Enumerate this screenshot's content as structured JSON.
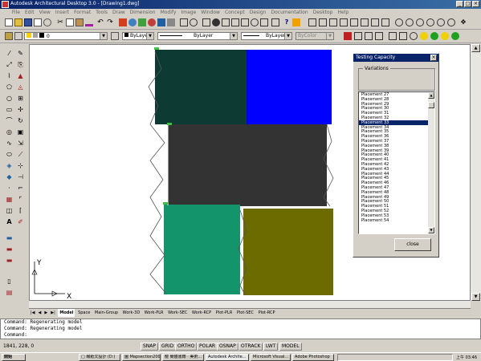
{
  "window": {
    "title": "Autodesk Architectural Desktop 3.0 - [Drawing1.dwg]",
    "minimize": "_",
    "maximize": "□",
    "close": "×"
  },
  "menu": [
    "File",
    "Edit",
    "View",
    "Insert",
    "Format",
    "Tools",
    "Draw",
    "Dimension",
    "Modify",
    "Image",
    "Window",
    "Concept",
    "Design",
    "Documentation",
    "Desktop",
    "Help"
  ],
  "toolbar": {
    "layer_combo": "0",
    "color_combo": "ByLayer",
    "linetype_combo": "ByLayer",
    "lineweight_combo": "ByLayer",
    "plotstyle_combo": "ByColor"
  },
  "canvas": {
    "ucs_y": "Y",
    "ucs_x": "X"
  },
  "tabs": [
    "Model",
    "Space",
    "Main-Group",
    "Work-3D",
    "Work-PLR",
    "Work-SEC",
    "Work-RCP",
    "Plot-PLR",
    "Plot-SEC",
    "Plot-RCP"
  ],
  "command": {
    "lines": [
      "Command:  Regenerating model",
      "Command:  Regenerating model",
      "Command:"
    ]
  },
  "status": {
    "coords": "1841, 228, 0",
    "toggles": [
      "SNAP",
      "GRID",
      "ORTHO",
      "POLAR",
      "OSNAP",
      "OTRACK",
      "LWT",
      "MODEL"
    ]
  },
  "taskbar": {
    "start": "開始",
    "tasks": [
      "□ 報紙文設計 (D:)",
      "圖 Mapsection2008-1...",
      "龍 簡體書籍 · 美術...",
      "Autodesk Archite...",
      "Microsoft Visual...",
      "Adobe Photoshop"
    ],
    "clock": "上午 03:46"
  },
  "dialog": {
    "title": "Testing Capacity",
    "group_label": "Variations",
    "items": [
      "Placement 27",
      "Placement 28",
      "Placement 29",
      "Placement 30",
      "Placement 31",
      "Placement 32",
      "Placement 33",
      "Placement 34",
      "Placement 35",
      "Placement 36",
      "Placement 37",
      "Placement 38",
      "Placement 39",
      "Placement 40",
      "Placement 41",
      "Placement 42",
      "Placement 43",
      "Placement 44",
      "Placement 45",
      "Placement 46",
      "Placement 47",
      "Placement 48",
      "Placement 49",
      "Placement 50",
      "Placement 51",
      "Placement 52",
      "Placement 53",
      "Placement 54"
    ],
    "selected": "Placement 33",
    "close_button": "close"
  },
  "colors": {
    "title_blue": "#0a246a",
    "dark_teal": "#0e3a34",
    "blue": "#0000ff",
    "charcoal": "#333333",
    "green": "#13946a",
    "olive": "#6b6b00"
  }
}
